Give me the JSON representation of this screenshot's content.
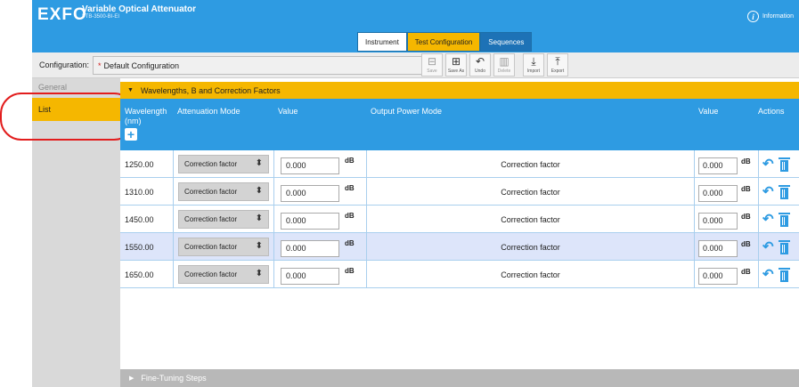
{
  "header": {
    "logo": "EXFO",
    "app_title": "Variable Optical Attenuator",
    "app_subtitle": "FTB-3500-BI-EI",
    "info_glyph": "i",
    "info_label": "Information"
  },
  "tabs": [
    {
      "label": "Instrument",
      "state": "inactive"
    },
    {
      "label": "Test Configuration",
      "state": "active"
    },
    {
      "label": "Sequences",
      "state": "inactive"
    }
  ],
  "config": {
    "label": "Configuration:",
    "modified_marker": "*",
    "value": "Default Configuration",
    "tools": [
      {
        "icon": "save-icon",
        "glyph": "⊟",
        "label": "Save",
        "enabled": false
      },
      {
        "icon": "save-as-icon",
        "glyph": "⊞",
        "label": "Save As",
        "enabled": true
      },
      {
        "icon": "undo-icon",
        "glyph": "↶",
        "label": "Undo",
        "enabled": true
      },
      {
        "icon": "delete-icon",
        "glyph": "▥",
        "label": "Delete",
        "enabled": false
      },
      {
        "icon": "import-icon",
        "glyph": "⤓",
        "label": "Import",
        "enabled": true
      },
      {
        "icon": "export-icon",
        "glyph": "⤒",
        "label": "Export",
        "enabled": true
      }
    ]
  },
  "sidebar": {
    "items": [
      {
        "label": "General",
        "selected": false
      },
      {
        "label": "List",
        "selected": true
      }
    ]
  },
  "section": {
    "title": "Wavelengths, B and Correction Factors",
    "expanded_glyph": "▼",
    "footer_title": "Fine-Tuning Steps",
    "collapsed_glyph": "▶"
  },
  "columns": {
    "wavelength": "Wavelength (nm)",
    "attenuation_mode": "Attenuation Mode",
    "value": "Value",
    "output_power_mode": "Output Power Mode",
    "value2": "Value",
    "actions": "Actions",
    "add_glyph": "+"
  },
  "rows": [
    {
      "wavelength": "1250.00",
      "mode": "Correction factor",
      "value": "0.000",
      "unit": "dB",
      "output_mode": "Correction factor",
      "value2": "0.000",
      "unit2": "dB",
      "highlighted": false
    },
    {
      "wavelength": "1310.00",
      "mode": "Correction factor",
      "value": "0.000",
      "unit": "dB",
      "output_mode": "Correction factor",
      "value2": "0.000",
      "unit2": "dB",
      "highlighted": false
    },
    {
      "wavelength": "1450.00",
      "mode": "Correction factor",
      "value": "0.000",
      "unit": "dB",
      "output_mode": "Correction factor",
      "value2": "0.000",
      "unit2": "dB",
      "highlighted": false
    },
    {
      "wavelength": "1550.00",
      "mode": "Correction factor",
      "value": "0.000",
      "unit": "dB",
      "output_mode": "Correction factor",
      "value2": "0.000",
      "unit2": "dB",
      "highlighted": true
    },
    {
      "wavelength": "1650.00",
      "mode": "Correction factor",
      "value": "0.000",
      "unit": "dB",
      "output_mode": "Correction factor",
      "value2": "0.000",
      "unit2": "dB",
      "highlighted": false
    }
  ],
  "colors": {
    "header_blue": "#2e9be2",
    "accent_yellow": "#f5b700",
    "annotation_red": "#e21d1d",
    "row_highlight": "#dde5fa"
  }
}
